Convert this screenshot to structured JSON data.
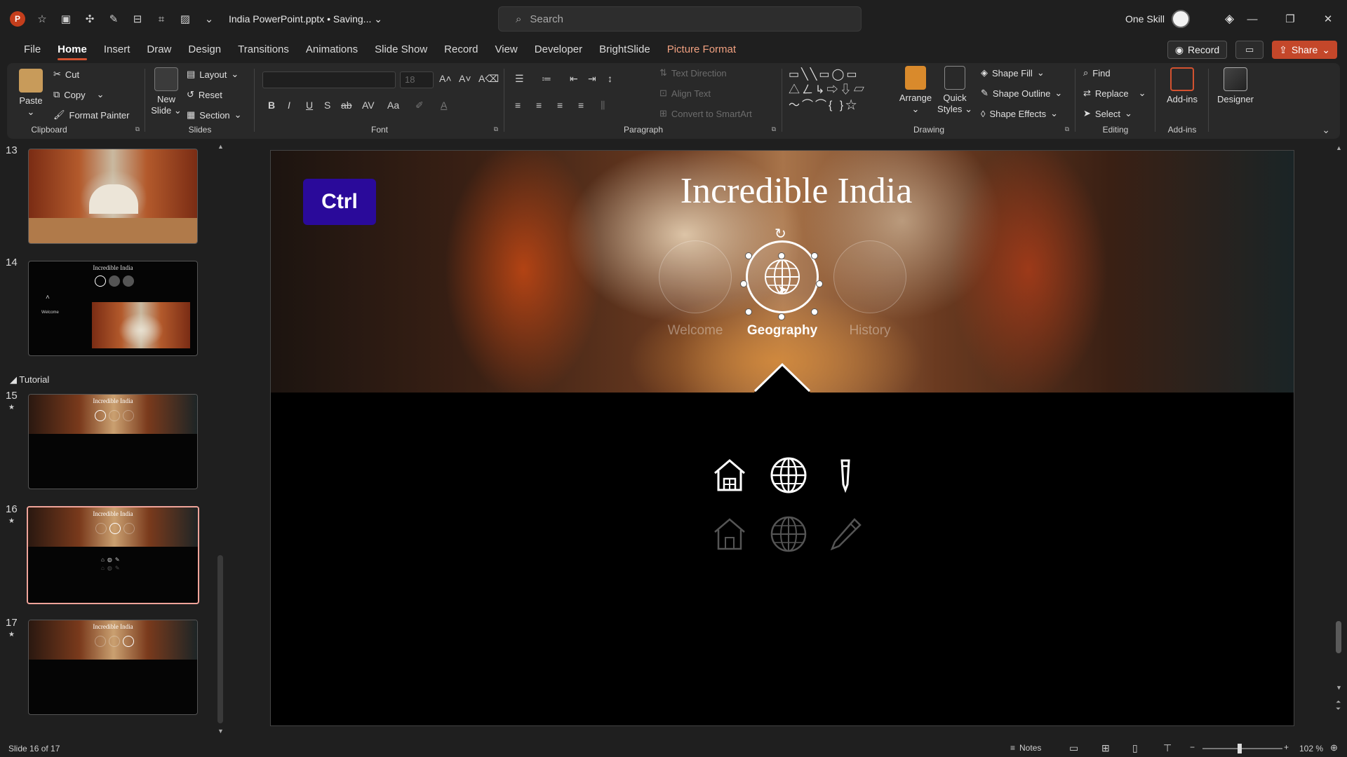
{
  "app": {
    "logo_letter": "P",
    "doc_title": "India PowerPoint.pptx • Saving...",
    "search_placeholder": "Search",
    "account_name": "One Skill"
  },
  "tabs": [
    "File",
    "Home",
    "Insert",
    "Draw",
    "Design",
    "Transitions",
    "Animations",
    "Slide Show",
    "Record",
    "View",
    "Developer",
    "BrightSlide",
    "Picture Format"
  ],
  "active_tab": "Home",
  "top_right": {
    "record": "Record",
    "share": "Share"
  },
  "ribbon": {
    "clipboard": {
      "paste": "Paste",
      "cut": "Cut",
      "copy": "Copy",
      "format_painter": "Format Painter",
      "label": "Clipboard"
    },
    "slides": {
      "new_slide": "New Slide",
      "layout": "Layout",
      "reset": "Reset",
      "section": "Section",
      "label": "Slides"
    },
    "font": {
      "name": "",
      "size": "18",
      "label": "Font"
    },
    "paragraph": {
      "text_direction": "Text Direction",
      "align_text": "Align Text",
      "smartart": "Convert to SmartArt",
      "label": "Paragraph"
    },
    "drawing": {
      "arrange": "Arrange",
      "quick_styles": "Quick Styles",
      "shape_fill": "Shape Fill",
      "shape_outline": "Shape Outline",
      "shape_effects": "Shape Effects",
      "label": "Drawing"
    },
    "editing": {
      "find": "Find",
      "replace": "Replace",
      "select": "Select",
      "label": "Editing"
    },
    "addins": {
      "addins": "Add-ins",
      "label": "Add-ins"
    },
    "designer": {
      "label": "Designer"
    }
  },
  "thumbnails": {
    "section_name": "Tutorial",
    "slides": [
      {
        "num": "13"
      },
      {
        "num": "14",
        "title": "Incredible India",
        "welcome": "Welcome"
      },
      {
        "num": "15",
        "title": "Incredible India"
      },
      {
        "num": "16",
        "title": "Incredible India"
      },
      {
        "num": "17",
        "title": "Incredible India"
      }
    ],
    "selected": "16"
  },
  "slide": {
    "title": "Incredible India",
    "ctrl_badge": "Ctrl",
    "nav": [
      {
        "label": "Welcome",
        "active": false
      },
      {
        "label": "Geography",
        "active": true
      },
      {
        "label": "History",
        "active": false
      }
    ]
  },
  "status": {
    "slide_counter": "Slide 16 of 17",
    "notes": "Notes",
    "zoom": "102 %"
  },
  "colors": {
    "accent": "#d35230",
    "share": "#c4472a",
    "ctrl_badge": "#2a0a9a",
    "selected_thumb": "#f0a49a"
  }
}
